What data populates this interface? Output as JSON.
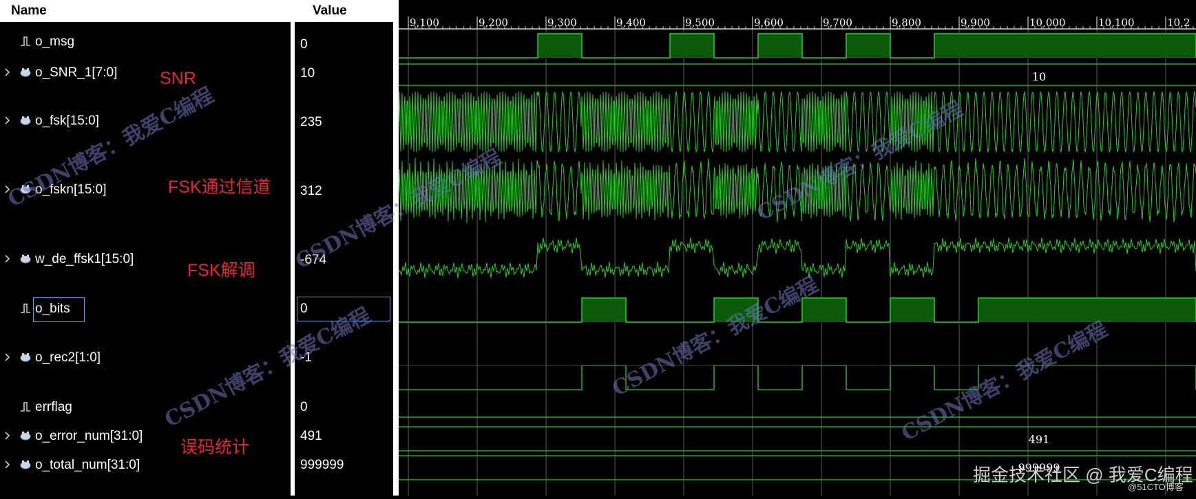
{
  "header": {
    "name_label": "Name",
    "value_label": "Value"
  },
  "signals": [
    {
      "name": "o_msg",
      "value": "0",
      "type": "bit",
      "expandable": false
    },
    {
      "name": "o_SNR_1[7:0]",
      "value": "10",
      "type": "bus",
      "expandable": true
    },
    {
      "name": "o_fsk[15:0]",
      "value": "235",
      "type": "bus",
      "expandable": true
    },
    {
      "name": "o_fskn[15:0]",
      "value": "312",
      "type": "bus",
      "expandable": true
    },
    {
      "name": "w_de_ffsk1[15:0]",
      "value": "-674",
      "type": "bus",
      "expandable": true
    },
    {
      "name": "o_bits",
      "value": "0",
      "type": "bit",
      "expandable": false,
      "selected": true
    },
    {
      "name": "o_rec2[1:0]",
      "value": "-1",
      "type": "bus",
      "expandable": true
    },
    {
      "name": "errflag",
      "value": "0",
      "type": "bit",
      "expandable": false
    },
    {
      "name": "o_error_num[31:0]",
      "value": "491",
      "type": "bus",
      "expandable": true
    },
    {
      "name": "o_total_num[31:0]",
      "value": "999999",
      "type": "bus",
      "expandable": true
    }
  ],
  "annotations": {
    "snr": "SNR",
    "fsk_channel": "FSK通过信道",
    "fsk_demod": "FSK解调",
    "error_stats": "误码统计"
  },
  "timeline": {
    "ticks": [
      "9,100",
      "9,200",
      "9,300",
      "9,400",
      "9,500",
      "9,600",
      "9,700",
      "9,800",
      "9,900",
      "10,000",
      "10,100",
      "10,2"
    ]
  },
  "bus_labels": {
    "snr": "10",
    "error_num": "491",
    "total_num": "999999"
  },
  "watermark": {
    "text": "CSDN博客：我爱C编程",
    "juejin": "掘金技术社区 @ 我爱C编程",
    "site": "@51CTO博客"
  },
  "colors": {
    "wave": "#1fd41f",
    "wave_fill": "#0a5a0a",
    "grid": "#5a5a5a",
    "annotation": "#e8262e",
    "selection": "#4aa3e0"
  },
  "icons": {
    "bit_signal": "bit-signal-icon",
    "bus_signal": "bus-signal-icon",
    "expand": "chevron-right-icon"
  }
}
